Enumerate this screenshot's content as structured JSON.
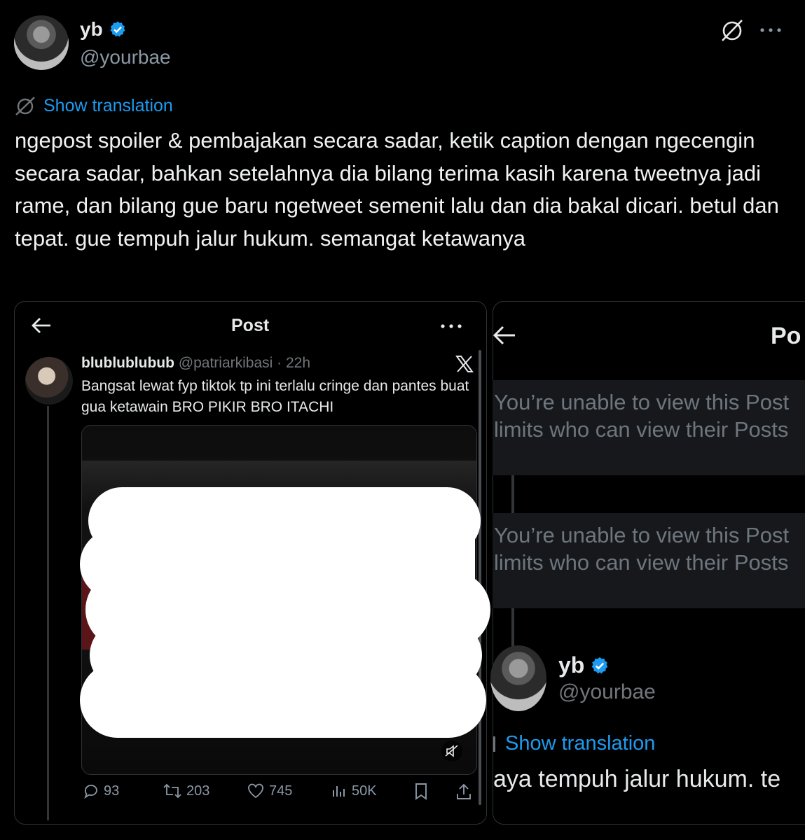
{
  "header": {
    "name": "yb",
    "handle": "@yourbae"
  },
  "translation": {
    "label": "Show translation"
  },
  "tweet": {
    "text": "ngepost spoiler & pembajakan secara sadar, ketik caption dengan ngecengin secara sadar, bahkan setelahnya dia bilang terima kasih karena tweetnya jadi rame, dan bilang gue baru ngetweet semenit lalu dan dia bakal dicari. betul dan tepat. gue tempuh jalur hukum. semangat ketawanya"
  },
  "screenshot_left": {
    "title": "Post",
    "author_name": "blublublubub",
    "author_handle_time": "@patriarkibasi · 22h",
    "text": "Bangsat lewat fyp tiktok tp ini terlalu cringe dan pantes buat gua ketawain BRO PIKIR BRO ITACHI",
    "stats": {
      "replies": "93",
      "reposts": "203",
      "likes": "745",
      "views": "50K"
    }
  },
  "screenshot_right": {
    "title_partial": "Po",
    "notice1": "You’re unable to view this Post\nlimits who can view their Posts",
    "notice2": "You’re unable to view this Post\nlimits who can view their Posts",
    "reply_name": "yb",
    "reply_handle": "@yourbae",
    "reply_translation": "Show translation",
    "reply_text": "aya tempuh jalur hukum. te"
  },
  "colors": {
    "background": "#000000",
    "text": "#e7e9ea",
    "accent": "#1d9bf0",
    "muted": "#71767b",
    "notice_bg": "#16181c"
  }
}
